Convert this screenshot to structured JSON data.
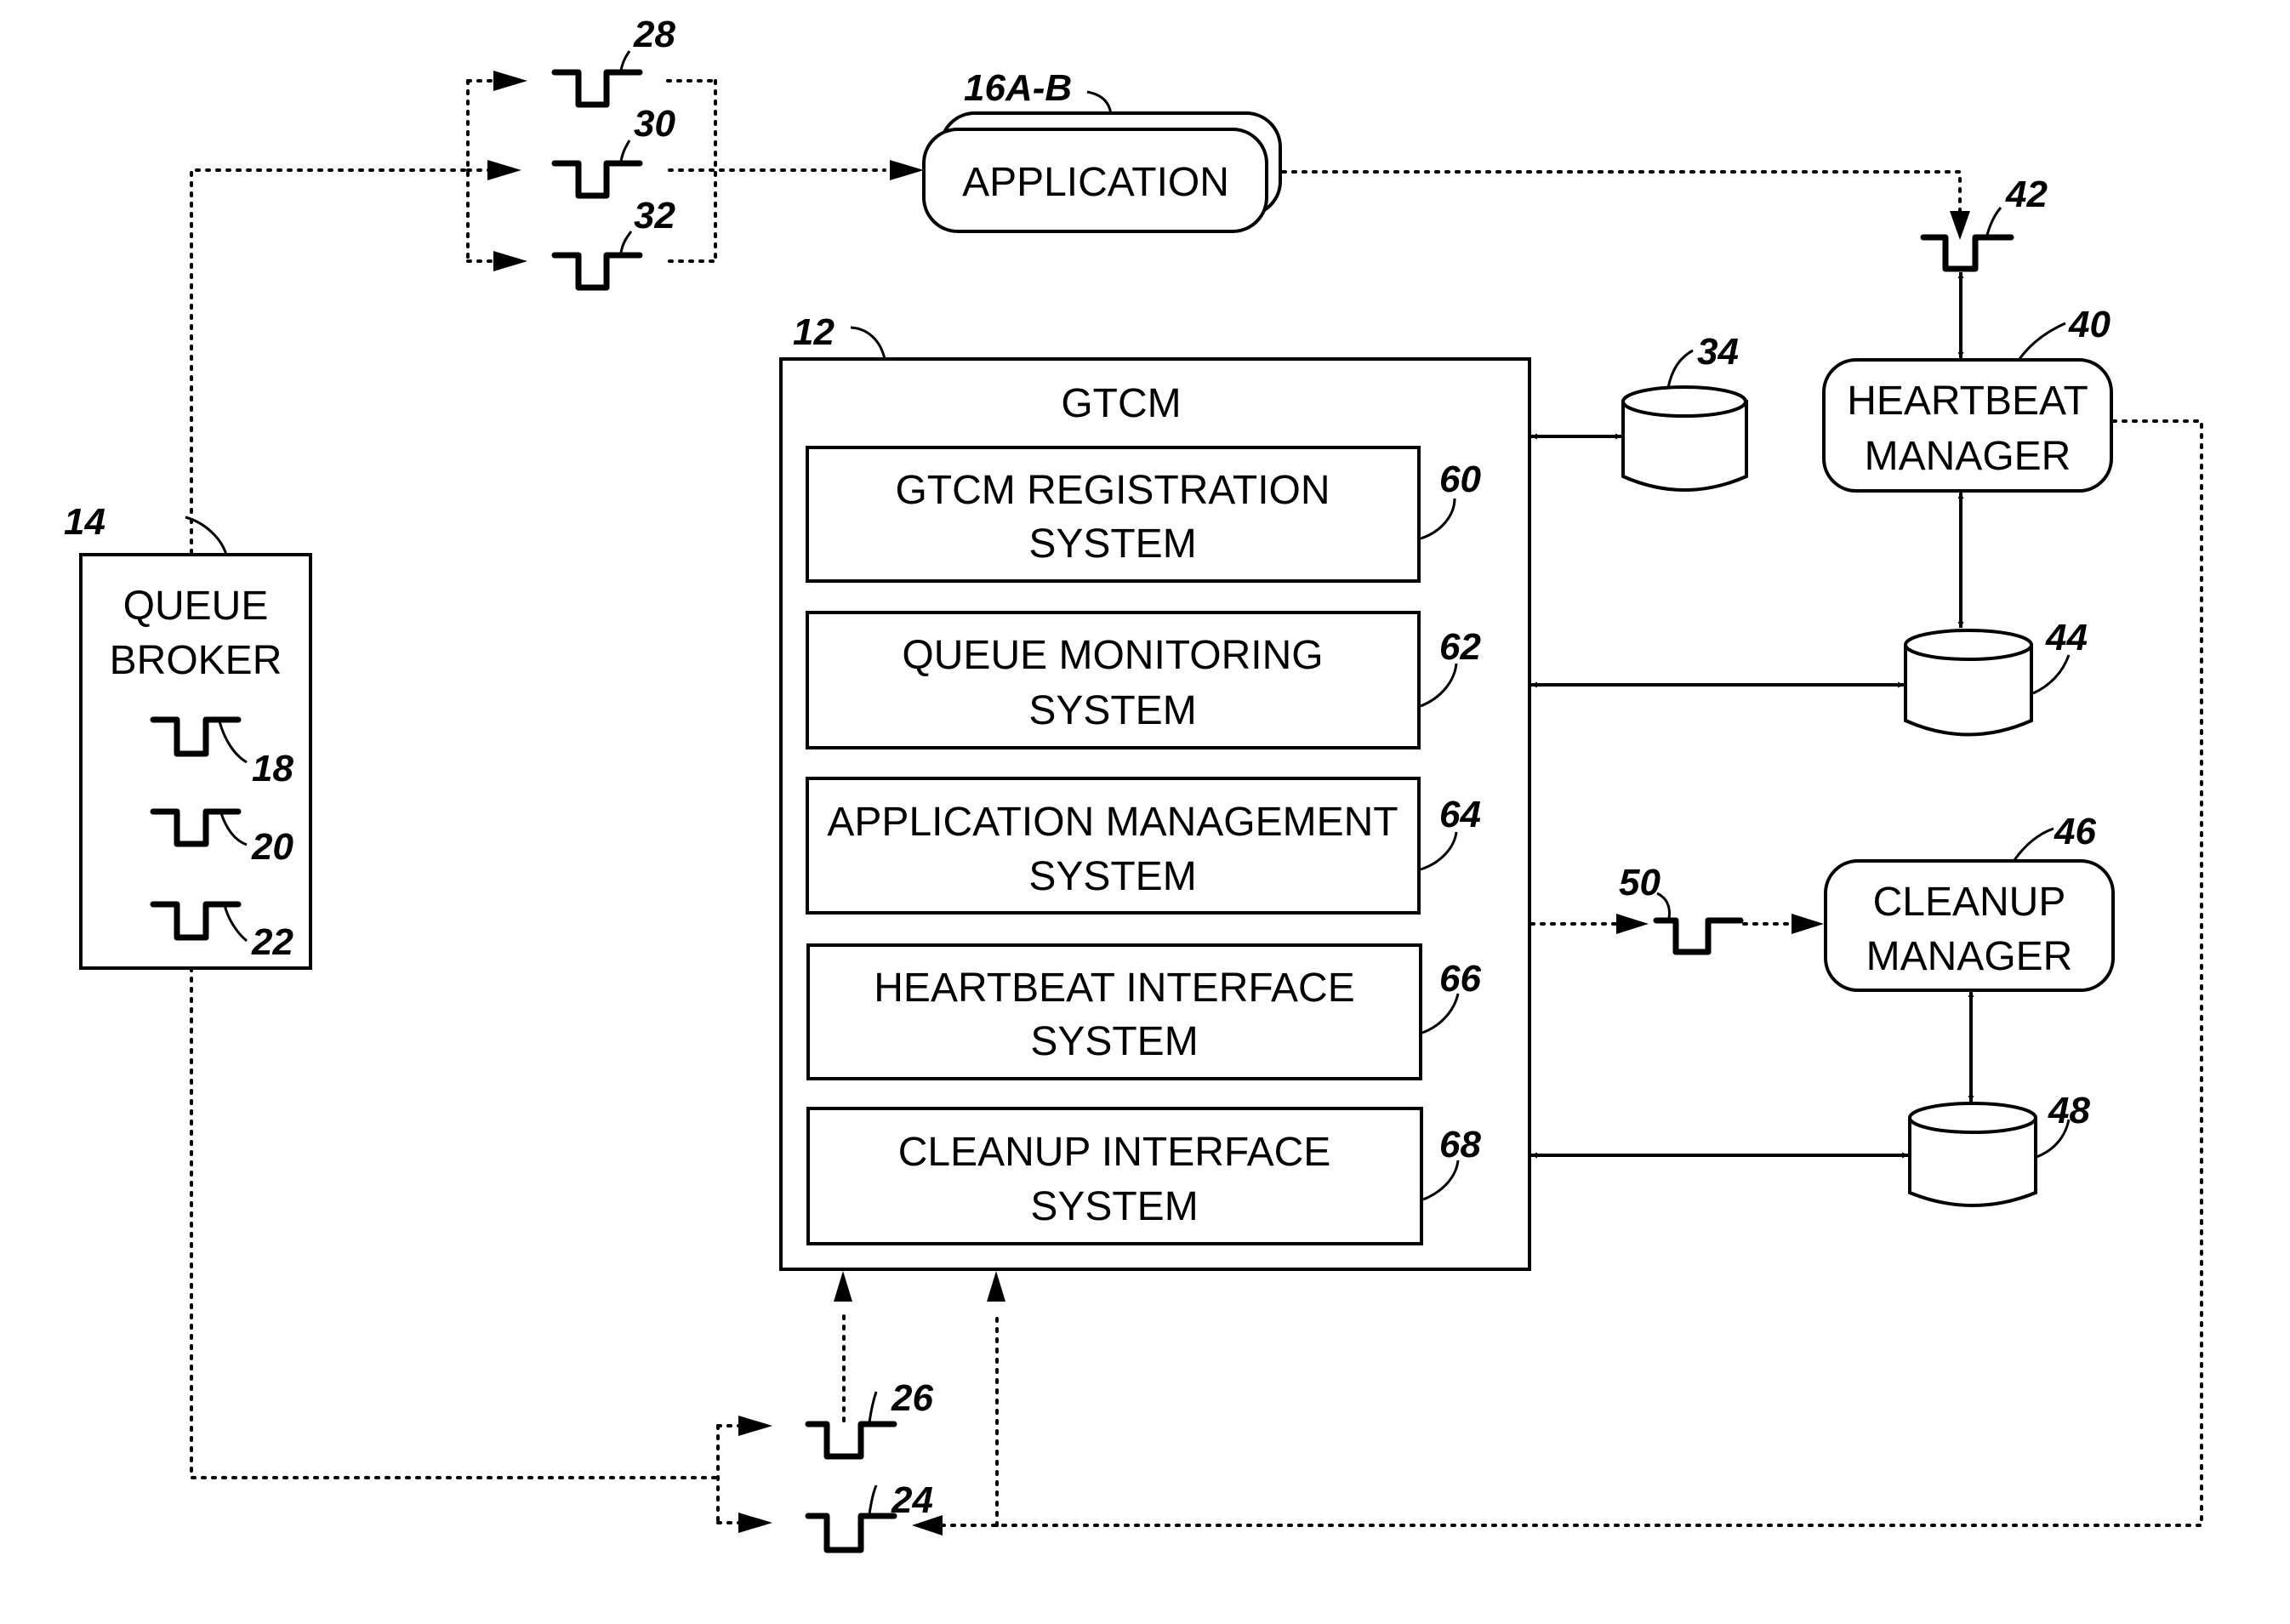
{
  "diagram": {
    "components": {
      "application": {
        "label": "APPLICATION",
        "ref": "16A-B"
      },
      "queue_broker": {
        "line1": "QUEUE",
        "line2": "BROKER",
        "ref": "14"
      },
      "gtcm": {
        "title": "GTCM",
        "ref": "12",
        "subsystems": [
          {
            "line1": "GTCM REGISTRATION",
            "line2": "SYSTEM",
            "ref": "60"
          },
          {
            "line1": "QUEUE MONITORING",
            "line2": "SYSTEM",
            "ref": "62"
          },
          {
            "line1": "APPLICATION MANAGEMENT",
            "line2": "SYSTEM",
            "ref": "64"
          },
          {
            "line1": "HEARTBEAT INTERFACE",
            "line2": "SYSTEM",
            "ref": "66"
          },
          {
            "line1": "CLEANUP INTERFACE",
            "line2": "SYSTEM",
            "ref": "68"
          }
        ]
      },
      "heartbeat_manager": {
        "line1": "HEARTBEAT",
        "line2": "MANAGER",
        "ref": "40"
      },
      "cleanup_manager": {
        "line1": "CLEANUP",
        "line2": "MANAGER",
        "ref": "46"
      }
    },
    "databases": {
      "gtcm_db": "34",
      "heartbeat_db": "44",
      "cleanup_db": "48"
    },
    "queues": {
      "broker_queues": [
        "18",
        "20",
        "22"
      ],
      "application_queues": [
        "28",
        "30",
        "32"
      ],
      "gtcm_input_queues": [
        "26",
        "24"
      ],
      "heartbeat_queue": "42",
      "cleanup_queue": "50"
    }
  }
}
